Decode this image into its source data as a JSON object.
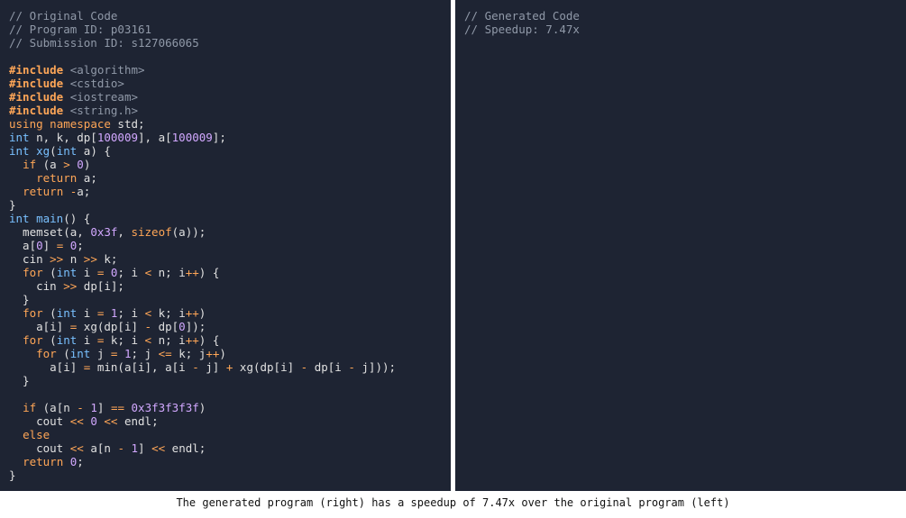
{
  "colors": {
    "pane_background": "#1e2433",
    "divider": "#ffffff",
    "comment": "#9099a8",
    "keyword": "#ffa657",
    "type": "#79c0ff",
    "number": "#d2a8ff",
    "plain": "#e0e0e0"
  },
  "left_pane": {
    "lines": [
      [
        [
          "comment",
          "// Original Code"
        ]
      ],
      [
        [
          "comment",
          "// Program ID: p03161"
        ]
      ],
      [
        [
          "comment",
          "// Submission ID: s127066065"
        ]
      ],
      [],
      [
        [
          "directive",
          "#include"
        ],
        [
          "plain",
          " "
        ],
        [
          "header",
          "<algorithm>"
        ]
      ],
      [
        [
          "directive",
          "#include"
        ],
        [
          "plain",
          " "
        ],
        [
          "header",
          "<cstdio>"
        ]
      ],
      [
        [
          "directive",
          "#include"
        ],
        [
          "plain",
          " "
        ],
        [
          "header",
          "<iostream>"
        ]
      ],
      [
        [
          "directive",
          "#include"
        ],
        [
          "plain",
          " "
        ],
        [
          "header",
          "<string.h>"
        ]
      ],
      [
        [
          "keyword",
          "using"
        ],
        [
          "plain",
          " "
        ],
        [
          "keyword",
          "namespace"
        ],
        [
          "plain",
          " std;"
        ]
      ],
      [
        [
          "type",
          "int"
        ],
        [
          "plain",
          " n, k, dp["
        ],
        [
          "number",
          "100009"
        ],
        [
          "plain",
          "], a["
        ],
        [
          "number",
          "100009"
        ],
        [
          "plain",
          "];"
        ]
      ],
      [
        [
          "type",
          "int"
        ],
        [
          "plain",
          " "
        ],
        [
          "func",
          "xg"
        ],
        [
          "plain",
          "("
        ],
        [
          "type",
          "int"
        ],
        [
          "plain",
          " a) {"
        ]
      ],
      [
        [
          "plain",
          "  "
        ],
        [
          "keyword",
          "if"
        ],
        [
          "plain",
          " (a "
        ],
        [
          "operator",
          ">"
        ],
        [
          "plain",
          " "
        ],
        [
          "number",
          "0"
        ],
        [
          "plain",
          ")"
        ]
      ],
      [
        [
          "plain",
          "    "
        ],
        [
          "keyword",
          "return"
        ],
        [
          "plain",
          " a;"
        ]
      ],
      [
        [
          "plain",
          "  "
        ],
        [
          "keyword",
          "return"
        ],
        [
          "plain",
          " "
        ],
        [
          "operator",
          "-"
        ],
        [
          "plain",
          "a;"
        ]
      ],
      [
        [
          "plain",
          "}"
        ]
      ],
      [
        [
          "type",
          "int"
        ],
        [
          "plain",
          " "
        ],
        [
          "func",
          "main"
        ],
        [
          "plain",
          "() {"
        ]
      ],
      [
        [
          "plain",
          "  memset(a, "
        ],
        [
          "number",
          "0x3f"
        ],
        [
          "plain",
          ", "
        ],
        [
          "builtin",
          "sizeof"
        ],
        [
          "plain",
          "(a));"
        ]
      ],
      [
        [
          "plain",
          "  a["
        ],
        [
          "number",
          "0"
        ],
        [
          "plain",
          "] "
        ],
        [
          "operator",
          "="
        ],
        [
          "plain",
          " "
        ],
        [
          "number",
          "0"
        ],
        [
          "plain",
          ";"
        ]
      ],
      [
        [
          "plain",
          "  cin "
        ],
        [
          "operator",
          ">>"
        ],
        [
          "plain",
          " n "
        ],
        [
          "operator",
          ">>"
        ],
        [
          "plain",
          " k;"
        ]
      ],
      [
        [
          "plain",
          "  "
        ],
        [
          "keyword",
          "for"
        ],
        [
          "plain",
          " ("
        ],
        [
          "type",
          "int"
        ],
        [
          "plain",
          " i "
        ],
        [
          "operator",
          "="
        ],
        [
          "plain",
          " "
        ],
        [
          "number",
          "0"
        ],
        [
          "plain",
          "; i "
        ],
        [
          "operator",
          "<"
        ],
        [
          "plain",
          " n; i"
        ],
        [
          "operator",
          "++"
        ],
        [
          "plain",
          ") {"
        ]
      ],
      [
        [
          "plain",
          "    cin "
        ],
        [
          "operator",
          ">>"
        ],
        [
          "plain",
          " dp[i];"
        ]
      ],
      [
        [
          "plain",
          "  }"
        ]
      ],
      [
        [
          "plain",
          "  "
        ],
        [
          "keyword",
          "for"
        ],
        [
          "plain",
          " ("
        ],
        [
          "type",
          "int"
        ],
        [
          "plain",
          " i "
        ],
        [
          "operator",
          "="
        ],
        [
          "plain",
          " "
        ],
        [
          "number",
          "1"
        ],
        [
          "plain",
          "; i "
        ],
        [
          "operator",
          "<"
        ],
        [
          "plain",
          " k; i"
        ],
        [
          "operator",
          "++"
        ],
        [
          "plain",
          ")"
        ]
      ],
      [
        [
          "plain",
          "    a[i] "
        ],
        [
          "operator",
          "="
        ],
        [
          "plain",
          " xg(dp[i] "
        ],
        [
          "operator",
          "-"
        ],
        [
          "plain",
          " dp["
        ],
        [
          "number",
          "0"
        ],
        [
          "plain",
          "]);"
        ]
      ],
      [
        [
          "plain",
          "  "
        ],
        [
          "keyword",
          "for"
        ],
        [
          "plain",
          " ("
        ],
        [
          "type",
          "int"
        ],
        [
          "plain",
          " i "
        ],
        [
          "operator",
          "="
        ],
        [
          "plain",
          " k; i "
        ],
        [
          "operator",
          "<"
        ],
        [
          "plain",
          " n; i"
        ],
        [
          "operator",
          "++"
        ],
        [
          "plain",
          ") {"
        ]
      ],
      [
        [
          "plain",
          "    "
        ],
        [
          "keyword",
          "for"
        ],
        [
          "plain",
          " ("
        ],
        [
          "type",
          "int"
        ],
        [
          "plain",
          " j "
        ],
        [
          "operator",
          "="
        ],
        [
          "plain",
          " "
        ],
        [
          "number",
          "1"
        ],
        [
          "plain",
          "; j "
        ],
        [
          "operator",
          "<="
        ],
        [
          "plain",
          " k; j"
        ],
        [
          "operator",
          "++"
        ],
        [
          "plain",
          ")"
        ]
      ],
      [
        [
          "plain",
          "      a[i] "
        ],
        [
          "operator",
          "="
        ],
        [
          "plain",
          " min(a[i], a[i "
        ],
        [
          "operator",
          "-"
        ],
        [
          "plain",
          " j] "
        ],
        [
          "operator",
          "+"
        ],
        [
          "plain",
          " xg(dp[i] "
        ],
        [
          "operator",
          "-"
        ],
        [
          "plain",
          " dp[i "
        ],
        [
          "operator",
          "-"
        ],
        [
          "plain",
          " j]));"
        ]
      ],
      [
        [
          "plain",
          "  }"
        ]
      ],
      [],
      [
        [
          "plain",
          "  "
        ],
        [
          "keyword",
          "if"
        ],
        [
          "plain",
          " (a[n "
        ],
        [
          "operator",
          "-"
        ],
        [
          "plain",
          " "
        ],
        [
          "number",
          "1"
        ],
        [
          "plain",
          "] "
        ],
        [
          "operator",
          "=="
        ],
        [
          "plain",
          " "
        ],
        [
          "number",
          "0x3f3f3f3f"
        ],
        [
          "plain",
          ")"
        ]
      ],
      [
        [
          "plain",
          "    cout "
        ],
        [
          "operator",
          "<<"
        ],
        [
          "plain",
          " "
        ],
        [
          "number",
          "0"
        ],
        [
          "plain",
          " "
        ],
        [
          "operator",
          "<<"
        ],
        [
          "plain",
          " endl;"
        ]
      ],
      [
        [
          "plain",
          "  "
        ],
        [
          "keyword",
          "else"
        ]
      ],
      [
        [
          "plain",
          "    cout "
        ],
        [
          "operator",
          "<<"
        ],
        [
          "plain",
          " a[n "
        ],
        [
          "operator",
          "-"
        ],
        [
          "plain",
          " "
        ],
        [
          "number",
          "1"
        ],
        [
          "plain",
          "] "
        ],
        [
          "operator",
          "<<"
        ],
        [
          "plain",
          " endl;"
        ]
      ],
      [
        [
          "plain",
          "  "
        ],
        [
          "keyword",
          "return"
        ],
        [
          "plain",
          " "
        ],
        [
          "number",
          "0"
        ],
        [
          "plain",
          ";"
        ]
      ],
      [
        [
          "plain",
          "}"
        ]
      ]
    ]
  },
  "right_pane": {
    "lines": [
      [
        [
          "comment",
          "// Generated Code"
        ]
      ],
      [
        [
          "comment",
          "// Speedup: 7.47x"
        ]
      ]
    ]
  },
  "caption": "The generated program (right) has a speedup of 7.47x over the original program (left)"
}
